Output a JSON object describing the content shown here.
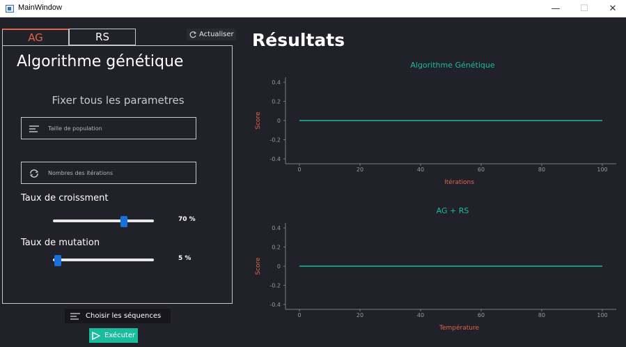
{
  "window": {
    "title": "MainWindow",
    "minimize": "—",
    "maximize": "☐",
    "close": "✕"
  },
  "tabs": [
    {
      "label": "AG",
      "active": true
    },
    {
      "label": "RS",
      "active": false
    }
  ],
  "refresh_label": "Actualiser",
  "panel": {
    "title": "Algorithme génétique",
    "subtitle": "Fixer tous les parametres",
    "population_placeholder": "Taille de population",
    "iterations_placeholder": "Nombres des itérations",
    "growth_label": "Taux de croissment",
    "growth_value_text": "70 %",
    "growth_value": 70,
    "mutation_label": "Taux de mutation",
    "mutation_value_text": "5 %",
    "mutation_value": 5
  },
  "buttons": {
    "choose_sequences": "Choisir les séquences",
    "execute": "Exécuter"
  },
  "results_title": "Résultats",
  "colors": {
    "accent": "#1abc9c",
    "active_tab": "#e0654b",
    "axis_label": "#e0654b",
    "slider_handle": "#1a6fd8",
    "background": "#21212a"
  },
  "chart_data": [
    {
      "type": "line",
      "title": "Algorithme Génétique",
      "xlabel": "Itérations",
      "ylabel": "Score",
      "xlim": [
        0,
        100
      ],
      "ylim": [
        -0.4,
        0.4
      ],
      "x_ticks": [
        0,
        20,
        40,
        60,
        80,
        100
      ],
      "y_ticks": [
        0.4,
        0.2,
        0,
        -0.2,
        -0.4
      ],
      "series": [
        {
          "x": [
            0,
            100
          ],
          "y": [
            0,
            0
          ],
          "color": "#1abc9c"
        }
      ]
    },
    {
      "type": "line",
      "title": "AG + RS",
      "xlabel": "Température",
      "ylabel": "Score",
      "xlim": [
        0,
        100
      ],
      "ylim": [
        -0.4,
        0.4
      ],
      "x_ticks": [
        0,
        20,
        40,
        60,
        80,
        100
      ],
      "y_ticks": [
        0.4,
        0.2,
        0,
        -0.2,
        -0.4
      ],
      "series": [
        {
          "x": [
            0,
            100
          ],
          "y": [
            0,
            0
          ],
          "color": "#1abc9c"
        }
      ]
    }
  ]
}
